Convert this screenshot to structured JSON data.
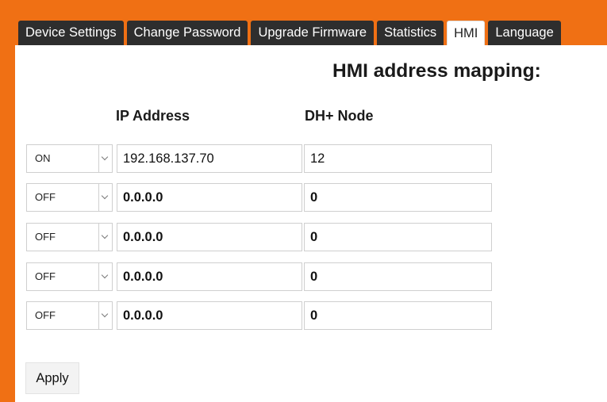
{
  "tabs": [
    {
      "label": "Device Settings"
    },
    {
      "label": "Change Password"
    },
    {
      "label": "Upgrade Firmware"
    },
    {
      "label": "Statistics"
    },
    {
      "label": "HMI"
    },
    {
      "label": "Language"
    }
  ],
  "active_tab": "HMI",
  "page_title": "HMI address mapping:",
  "columns": {
    "ip": "IP Address",
    "node": "DH+ Node"
  },
  "rows": [
    {
      "state": "ON",
      "ip": "192.168.137.70",
      "node": "12"
    },
    {
      "state": "OFF",
      "ip": "0.0.0.0",
      "node": "0"
    },
    {
      "state": "OFF",
      "ip": "0.0.0.0",
      "node": "0"
    },
    {
      "state": "OFF",
      "ip": "0.0.0.0",
      "node": "0"
    },
    {
      "state": "OFF",
      "ip": "0.0.0.0",
      "node": "0"
    }
  ],
  "apply_label": "Apply",
  "colors": {
    "frame": "#f07014",
    "tab_bg": "#2e2e2e"
  }
}
